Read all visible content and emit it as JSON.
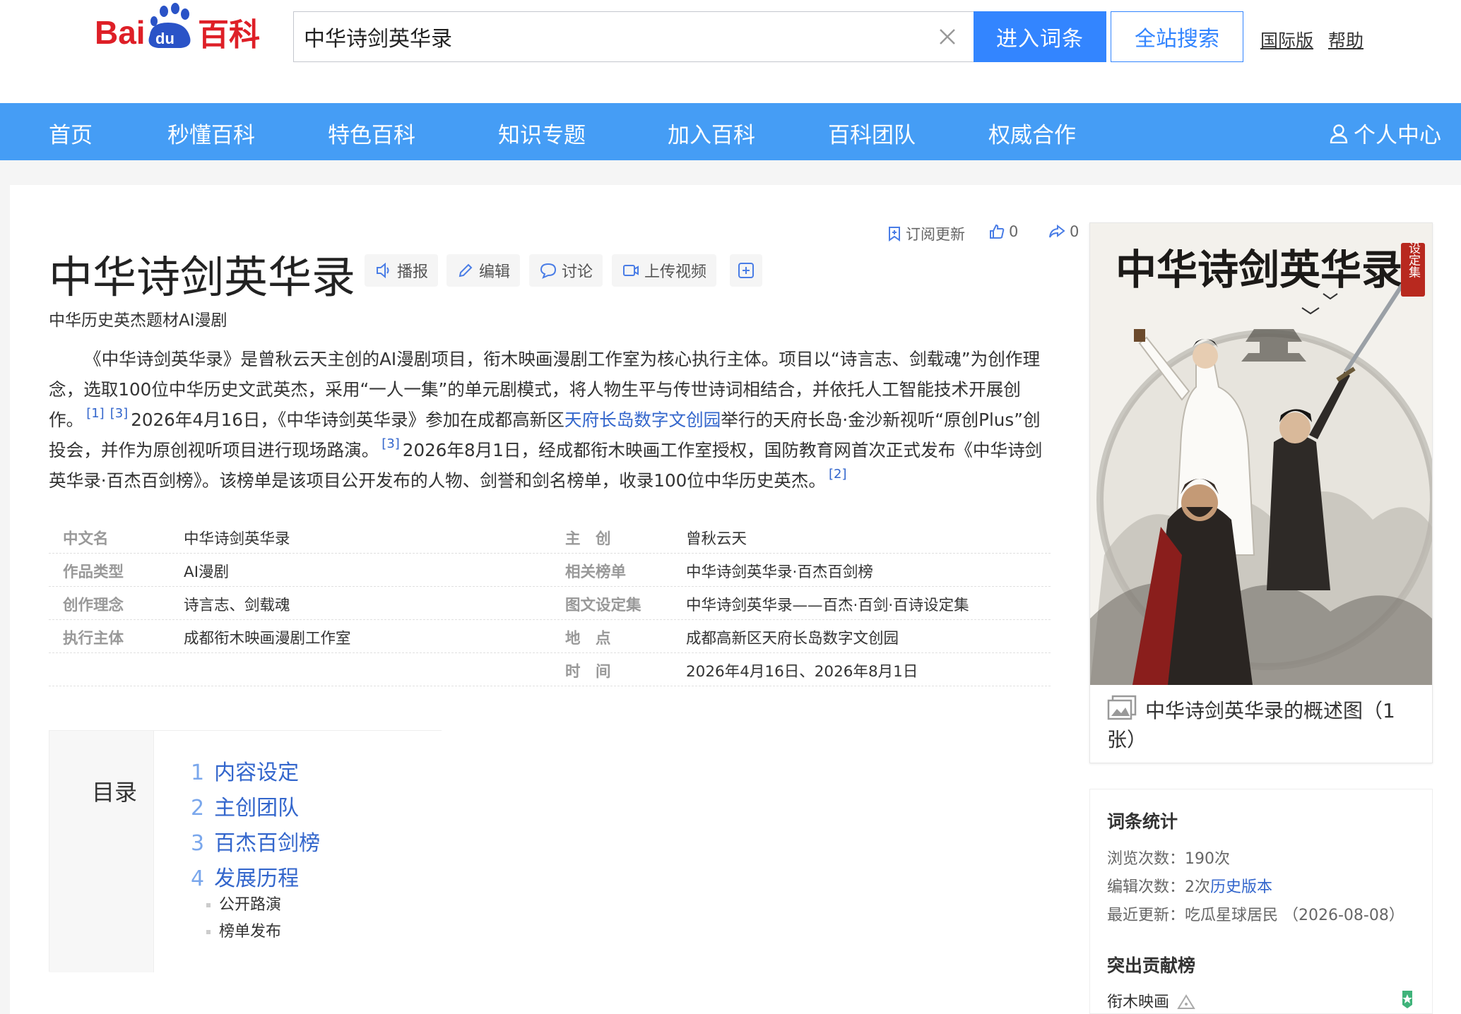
{
  "header": {
    "logo_text": "Bai du 百科",
    "search_value": "中华诗剑英华录",
    "enter_label": "进入词条",
    "site_search_label": "全站搜索",
    "intl_label": "国际版",
    "help_label": "帮助"
  },
  "nav": {
    "items": [
      "首页",
      "秒懂百科",
      "特色百科",
      "知识专题",
      "加入百科",
      "百科团队",
      "权威合作"
    ],
    "user_label": "个人中心"
  },
  "article": {
    "title": "中华诗剑英华录",
    "tools": [
      "播报",
      "编辑",
      "讨论",
      "上传视频"
    ],
    "subscribe_label": "订阅更新",
    "like_count": "0",
    "share_count": "0",
    "subtitle": "中华历史英杰题材AI漫剧",
    "summary": {
      "p1": "《中华诗剑英华录》是曾秋云天主创的AI漫剧项目，衔木映画漫剧工作室为核心执行主体。项目以“诗言志、剑载魂”为创作理念，选取100位中华历史文武英杰，采用“一人一集”的单元剧模式，将人物生平与传世诗词相结合，并依托人工智能技术开展创作。",
      "ref1": "[1]",
      "ref2": "[3]",
      "p2a": "2026年4月16日，《中华诗剑英华录》参加在成都高新区",
      "p2_link": "天府长岛数字文创园",
      "p2b": "举行的天府长岛·金沙新视听“原创Plus”创投会，并作为原创视听项目进行现场路演。",
      "ref3": "[3]",
      "p3": "2026年8月1日，经成都衔木映画工作室授权，国防教育网首次正式发布《中华诗剑英华录·百杰百剑榜》。该榜单是该项目公开发布的人物、剑誉和剑名榜单，收录100位中华历史英杰。",
      "ref4": "[2]"
    },
    "info_left": [
      {
        "name": "中文名",
        "value": "中华诗剑英华录"
      },
      {
        "name": "作品类型",
        "value": "AI漫剧"
      },
      {
        "name": "创作理念",
        "value": "诗言志、剑载魂"
      },
      {
        "name": "执行主体",
        "value": "成都衔木映画漫剧工作室"
      }
    ],
    "info_right": [
      {
        "name": "主　创",
        "value": "曾秋云天"
      },
      {
        "name": "相关榜单",
        "value": "中华诗剑英华录·百杰百剑榜"
      },
      {
        "name": "图文设定集",
        "value": "中华诗剑英华录——百杰·百剑·百诗设定集"
      },
      {
        "name": "地　点",
        "value": "成都高新区天府长岛数字文创园"
      },
      {
        "name": "时　间",
        "value": "2026年4月16日、2026年8月1日"
      }
    ],
    "catalog": {
      "title": "目录",
      "items": [
        {
          "num": "1",
          "label": "内容设定"
        },
        {
          "num": "2",
          "label": "主创团队"
        },
        {
          "num": "3",
          "label": "百杰百剑榜"
        },
        {
          "num": "4",
          "label": "发展历程"
        }
      ],
      "subitems": [
        "公开路演",
        "榜单发布"
      ]
    }
  },
  "sidebar": {
    "image_title": "中华诗剑英华录",
    "image_seal": "设定集",
    "image_caption": "中华诗剑英华录的概述图（1张）",
    "stats_title": "词条统计",
    "views": "浏览次数：190次",
    "edits_prefix": "编辑次数：2次",
    "edits_link": "历史版本",
    "updated": "最近更新：吃瓜星球居民 （2026-08-08）",
    "contrib_title": "突出贡献榜",
    "contributor": "衔木映画"
  },
  "colors": {
    "brand_blue": "#3385ff",
    "nav_blue": "#459df5",
    "link": "#3366cc",
    "baidu_red": "#de1f27"
  }
}
